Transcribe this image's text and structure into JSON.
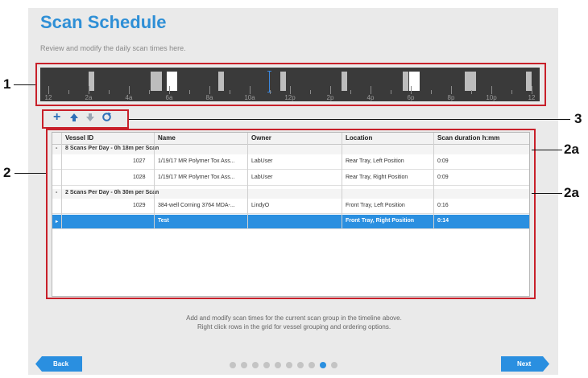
{
  "page": {
    "title": "Scan Schedule",
    "subtitle": "Review and modify the daily scan times here."
  },
  "callouts": {
    "c1": "1",
    "c2": "2",
    "c3": "3",
    "c2a_top": "2a",
    "c2a_bottom": "2a"
  },
  "timeline": {
    "labels": [
      "12",
      "2a",
      "4a",
      "6a",
      "8a",
      "10a",
      "12p",
      "2p",
      "4p",
      "6p",
      "8p",
      "10p",
      "12"
    ]
  },
  "toolbar": {
    "add_icon": "plus-icon",
    "move_up_icon": "arrow-up-icon",
    "move_down_icon": "arrow-down-icon",
    "refresh_icon": "refresh-icon"
  },
  "grid": {
    "columns": [
      "Vessel ID",
      "Name",
      "Owner",
      "Location",
      "Scan duration h:mm"
    ],
    "groups": [
      {
        "label": "8 Scans Per Day - 0h 18m per Scan"
      },
      {
        "label": "2 Scans Per Day - 0h 30m per Scan"
      }
    ],
    "rows": [
      {
        "vessel_id": "1027",
        "name": "1/19/17 MR Polymer Tox Ass...",
        "owner": "LabUser",
        "location": "Rear Tray, Left Position",
        "duration": "0:09"
      },
      {
        "vessel_id": "1028",
        "name": "1/19/17 MR Polymer Tox Ass...",
        "owner": "LabUser",
        "location": "Rear Tray, Right Position",
        "duration": "0:09"
      },
      {
        "vessel_id": "1029",
        "name": "384-well Corning 3764 MDA-...",
        "owner": "LindyO",
        "location": "Front Tray, Left Position",
        "duration": "0:16"
      },
      {
        "vessel_id": "",
        "name": "Test",
        "owner": "",
        "location": "Front Tray, Right Position",
        "duration": "0:14"
      }
    ]
  },
  "help": {
    "line1": "Add and modify scan times for the current scan group in the timeline above.",
    "line2": "Right click rows in the grid for vessel grouping and ordering options."
  },
  "nav": {
    "back": "Back",
    "next": "Next",
    "dot_count": 10,
    "active_dot": 8
  },
  "colors": {
    "accent": "#2a8fe0",
    "callout_red": "#c8202a",
    "title_blue": "#2e8fd6"
  }
}
